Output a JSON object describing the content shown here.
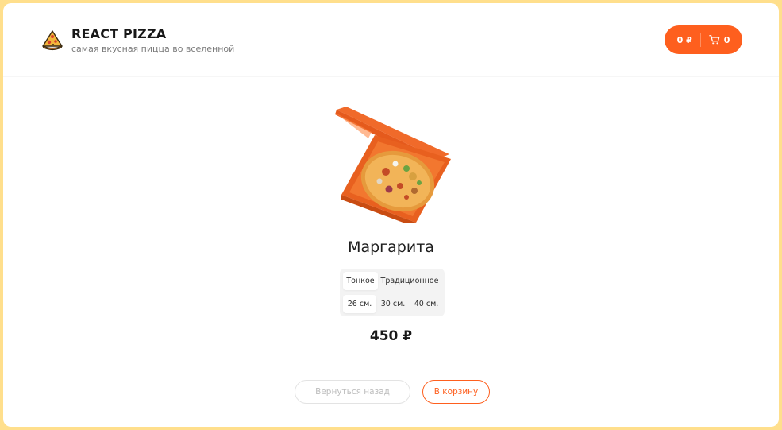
{
  "header": {
    "title": "REACT PIZZA",
    "subtitle": "самая вкусная пицца во вселенной",
    "logo_icon": "pizza-slice-icon",
    "cart": {
      "price": "0 ₽",
      "count": "0",
      "icon": "shopping-cart-icon"
    }
  },
  "product": {
    "image": "pizza-in-box",
    "name": "Маргарита",
    "types": [
      {
        "label": "Тонкое",
        "active": true
      },
      {
        "label": "Традиционное",
        "active": false
      }
    ],
    "sizes": [
      {
        "label": "26 см.",
        "active": true
      },
      {
        "label": "30 см.",
        "active": false
      },
      {
        "label": "40 см.",
        "active": false
      }
    ],
    "price": "450 ₽"
  },
  "actions": {
    "back_label": "Вернуться назад",
    "cart_label": "В корзину"
  },
  "colors": {
    "accent": "#fe5f1e",
    "background": "#ffdf8c"
  }
}
